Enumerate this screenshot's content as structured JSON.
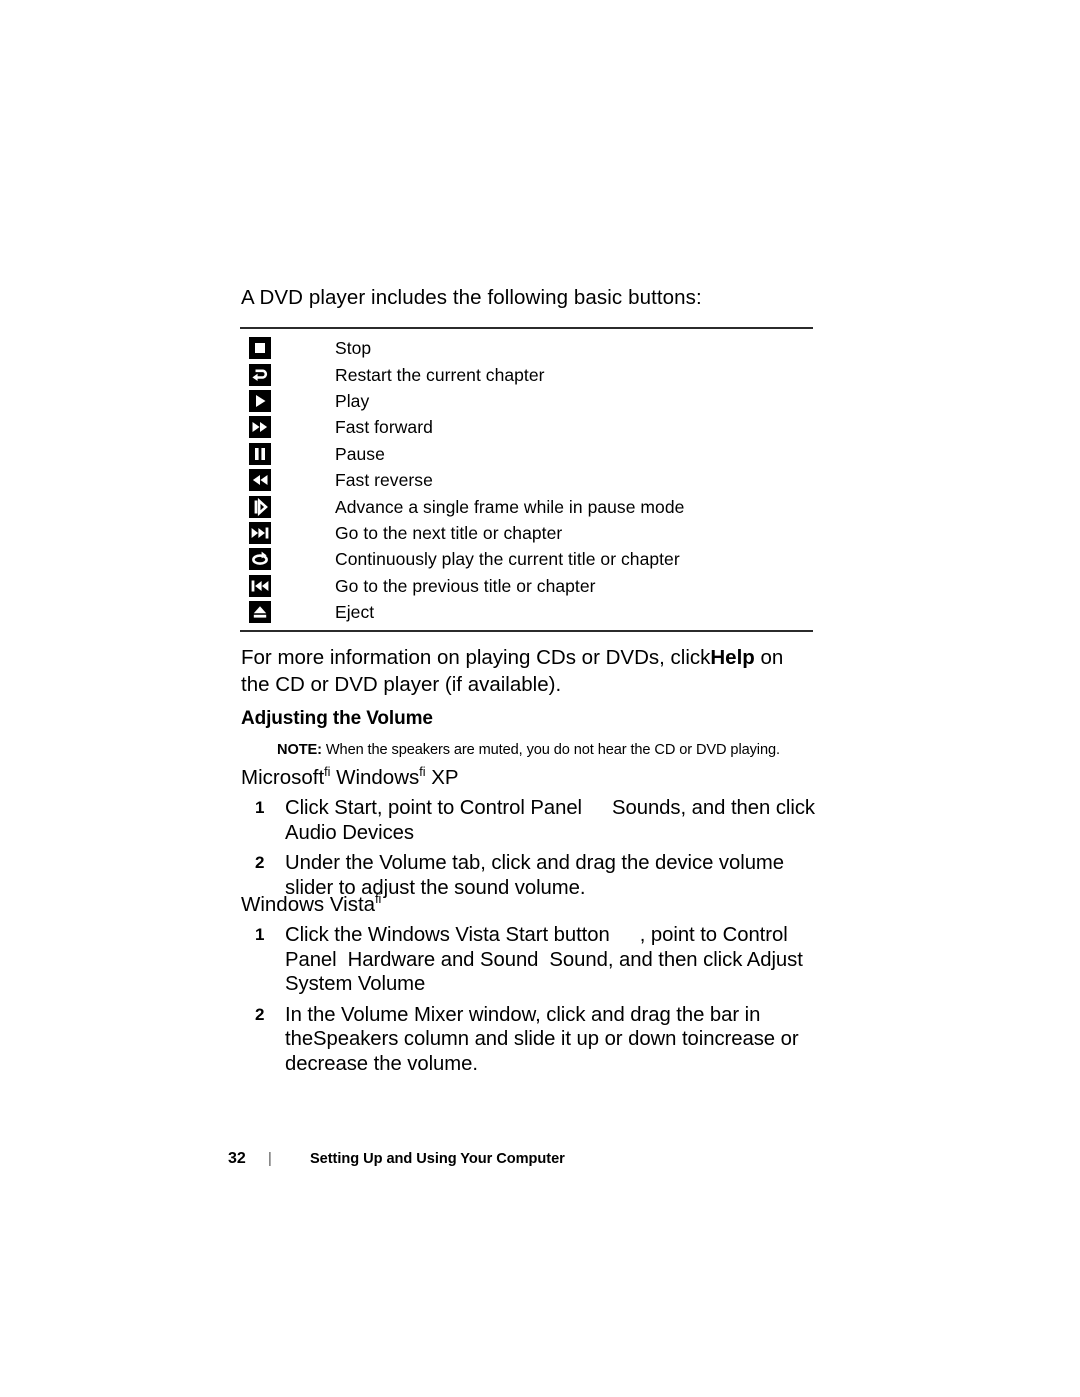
{
  "document": {
    "intro": "A DVD player includes the following basic buttons:",
    "buttons": [
      {
        "icon": "stop-icon",
        "label": "Stop"
      },
      {
        "icon": "restart-chapter-icon",
        "label": "Restart the current chapter"
      },
      {
        "icon": "play-icon",
        "label": "Play"
      },
      {
        "icon": "fast-forward-icon",
        "label": "Fast forward"
      },
      {
        "icon": "pause-icon",
        "label": "Pause"
      },
      {
        "icon": "fast-reverse-icon",
        "label": "Fast reverse"
      },
      {
        "icon": "frame-advance-icon",
        "label": "Advance a single frame while in pause mode"
      },
      {
        "icon": "next-title-icon",
        "label": "Go to the next title or chapter"
      },
      {
        "icon": "repeat-loop-icon",
        "label": "Continuously play the current title or chapter"
      },
      {
        "icon": "previous-title-icon",
        "label": "Go to the previous title or chapter"
      },
      {
        "icon": "eject-icon",
        "label": "Eject"
      }
    ],
    "paragraph": {
      "before": "For more information on playing CDs or DVDs, click",
      "bold": "Help",
      "after": " on the CD or DVD player (if available)."
    },
    "section_heading": "Adjusting the Volume",
    "note": {
      "label": "NOTE:",
      "text": "When the speakers are muted, you do not hear the CD or DVD playing."
    },
    "os_xp": {
      "heading_part1": "Microsoft",
      "heading_sup1": "fi",
      "heading_part2": " Windows",
      "heading_sup2": "fi",
      "heading_part3": " XP",
      "steps": [
        {
          "num": "1",
          "seg1": "Click ",
          "b1": "Start",
          "seg2": ", point to ",
          "b2": "Control Panel",
          "seg3": "",
          "b3": "Sounds",
          "seg4": ", and then click ",
          "b4": "Audio Devices"
        },
        {
          "num": "2",
          "seg1": "Under the ",
          "b1": "Volume",
          "seg2": " tab, click and drag the device volume slider to adjust the sound volume.",
          "b2": "",
          "seg3": "",
          "b3": "",
          "seg4": "",
          "b4": ""
        }
      ]
    },
    "os_vista": {
      "heading_part1": "Windows Vista",
      "heading_sup1": "fi",
      "steps": [
        {
          "num": "1",
          "seg1": "Click the Windows Vista Start button",
          "b1": "",
          "seg2": ", point to ",
          "b2": "Control Panel",
          "seg3": "",
          "b3": "Hardware and Sound",
          "seg4": "",
          "b4": "Sound",
          "seg5": ", and then click ",
          "b5": "Adjust System Volume"
        },
        {
          "num": "2",
          "seg1": "In the Volume Mixer window, click and drag the bar in the",
          "b1": "Speakers",
          "seg2": " column and slide it up or down to",
          "b2": "increase",
          "seg3": " or ",
          "b3": "decrease",
          "seg4": " the volume.",
          "b4": ""
        }
      ]
    },
    "footer": {
      "page_number": "32",
      "separator": "|",
      "title": "Setting Up and Using Your Computer"
    }
  }
}
